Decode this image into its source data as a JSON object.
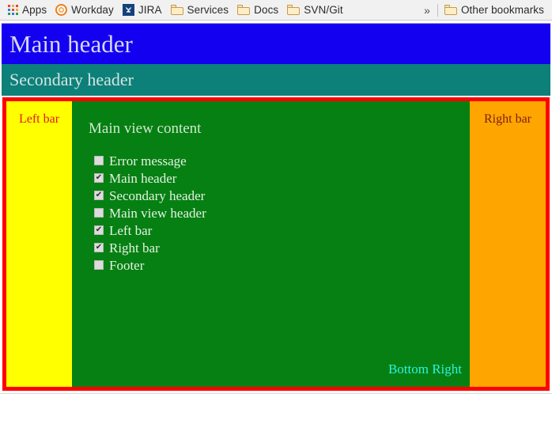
{
  "browser": {
    "bookmarks_bar": {
      "items": [
        {
          "label": "Apps",
          "icon": "apps-grid-icon"
        },
        {
          "label": "Workday",
          "icon": "workday-ring-icon"
        },
        {
          "label": "JIRA",
          "icon": "jira-icon"
        },
        {
          "label": "Services",
          "icon": "folder-icon"
        },
        {
          "label": "Docs",
          "icon": "folder-icon"
        },
        {
          "label": "SVN/Git",
          "icon": "folder-icon"
        }
      ],
      "overflow_label": "»",
      "other_bookmarks": {
        "label": "Other bookmarks",
        "icon": "folder-icon"
      }
    }
  },
  "page": {
    "main_header": {
      "title": "Main header",
      "background": "#1400f0",
      "text_color": "#d7d7f5"
    },
    "secondary_header": {
      "title": "Secondary header",
      "background": "#0d8079",
      "text_color": "#d4e4e2"
    },
    "content_frame": {
      "border_color": "#fd0000"
    },
    "left_bar": {
      "label": "Left bar",
      "background": "#ffff00",
      "text_color": "#e01b1b"
    },
    "right_bar": {
      "label": "Right bar",
      "background": "#ffa500",
      "text_color": "#7d2010"
    },
    "main_view": {
      "background": "#068012",
      "title": "Main view content",
      "bottom_right_label": "Bottom Right",
      "bottom_right_color": "#2ef2e0",
      "checkboxes": [
        {
          "label": "Error message",
          "checked": false
        },
        {
          "label": "Main header",
          "checked": true
        },
        {
          "label": "Secondary header",
          "checked": true
        },
        {
          "label": "Main view header",
          "checked": false
        },
        {
          "label": "Left bar",
          "checked": true
        },
        {
          "label": "Right bar",
          "checked": true
        },
        {
          "label": "Footer",
          "checked": false
        }
      ],
      "check_glyph": "✔"
    }
  }
}
